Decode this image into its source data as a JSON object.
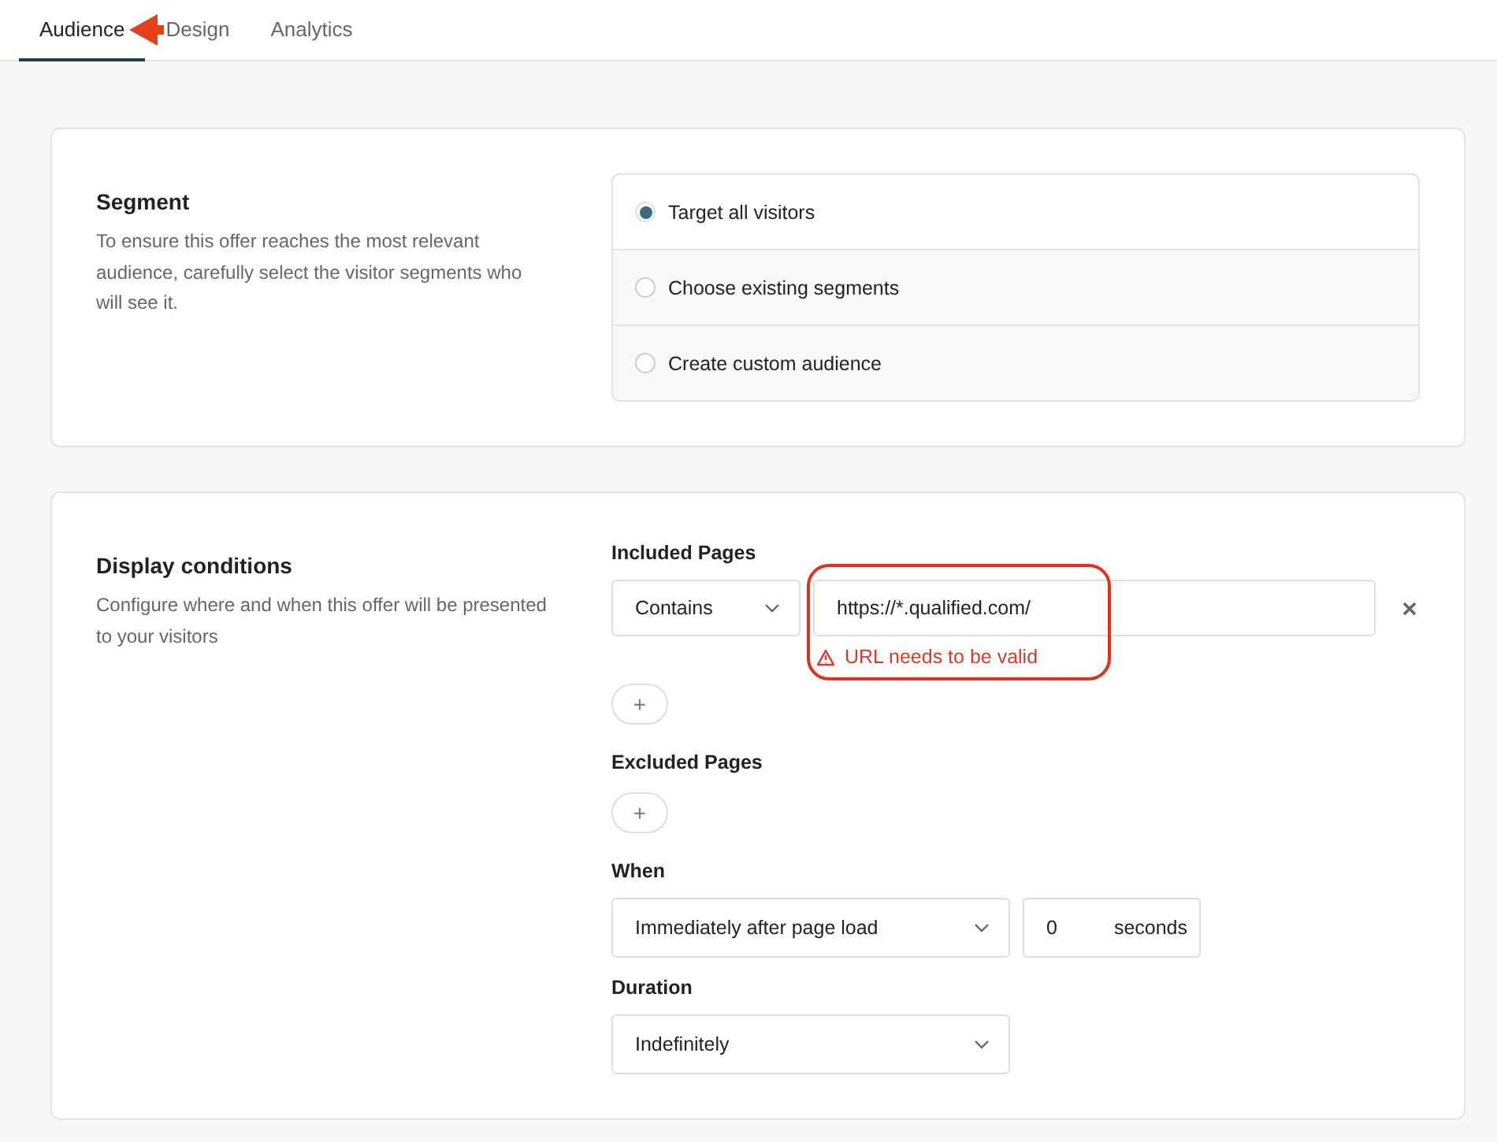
{
  "tabs": [
    {
      "label": "Audience",
      "selected": true
    },
    {
      "label": "Design",
      "selected": false
    },
    {
      "label": "Analytics",
      "selected": false
    }
  ],
  "segment": {
    "title": "Segment",
    "description": "To ensure this offer reaches the most relevant audience, carefully select the visitor segments who will see it.",
    "options": [
      {
        "label": "Target all visitors",
        "selected": true
      },
      {
        "label": "Choose existing segments",
        "selected": false
      },
      {
        "label": "Create custom audience",
        "selected": false
      }
    ]
  },
  "display_conditions": {
    "title": "Display conditions",
    "description": "Configure where and when this offer will be presented to your visitors",
    "included_pages": {
      "label": "Included Pages",
      "rules": [
        {
          "match": "Contains",
          "url": "https://*.qualified.com/",
          "error": "URL needs to be valid"
        }
      ],
      "add_button": "+"
    },
    "excluded_pages": {
      "label": "Excluded Pages",
      "add_button": "+"
    },
    "when": {
      "label": "When",
      "value": "Immediately after page load",
      "seconds": "0",
      "unit": "seconds"
    },
    "duration": {
      "label": "Duration",
      "value": "Indefinitely"
    }
  }
}
